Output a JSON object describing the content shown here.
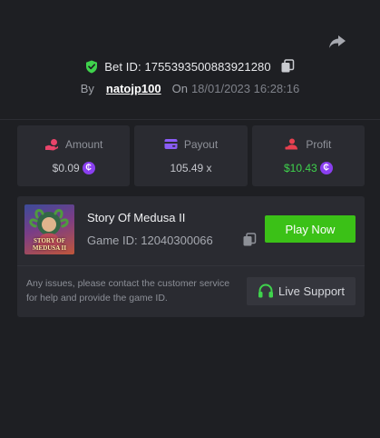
{
  "bet": {
    "label": "Bet ID:",
    "id": "1755393500883921280",
    "by_label": "By",
    "username": "natojp100",
    "on_label": "On",
    "datetime": "18/01/2023 16:28:16"
  },
  "stats": {
    "amount": {
      "label": "Amount",
      "value": "$0.09"
    },
    "payout": {
      "label": "Payout",
      "value": "105.49 x"
    },
    "profit": {
      "label": "Profit",
      "value": "$10.43"
    }
  },
  "currency_glyph": "₵",
  "game": {
    "name": "Story Of Medusa II",
    "id_text": "Game ID: 12040300066",
    "thumb_title": "STORY OF MEDUSA II",
    "play_label": "Play Now"
  },
  "support": {
    "text": "Any issues, please contact the customer service for help and provide the game ID.",
    "button_label": "Live Support"
  },
  "colors": {
    "background": "#1e1f23",
    "card": "#2a2b31",
    "accent_green": "#3bc117",
    "profit_green": "#3fd34c",
    "coin_purple": "#8a3ff0",
    "icon_pink": "#e8446a",
    "icon_purple": "#8a5cf6",
    "icon_red": "#e8404f"
  },
  "icons": [
    "share-icon",
    "shield-check-icon",
    "copy-icon",
    "money-hand-icon",
    "wallet-icon",
    "user-profit-icon",
    "headset-icon"
  ]
}
